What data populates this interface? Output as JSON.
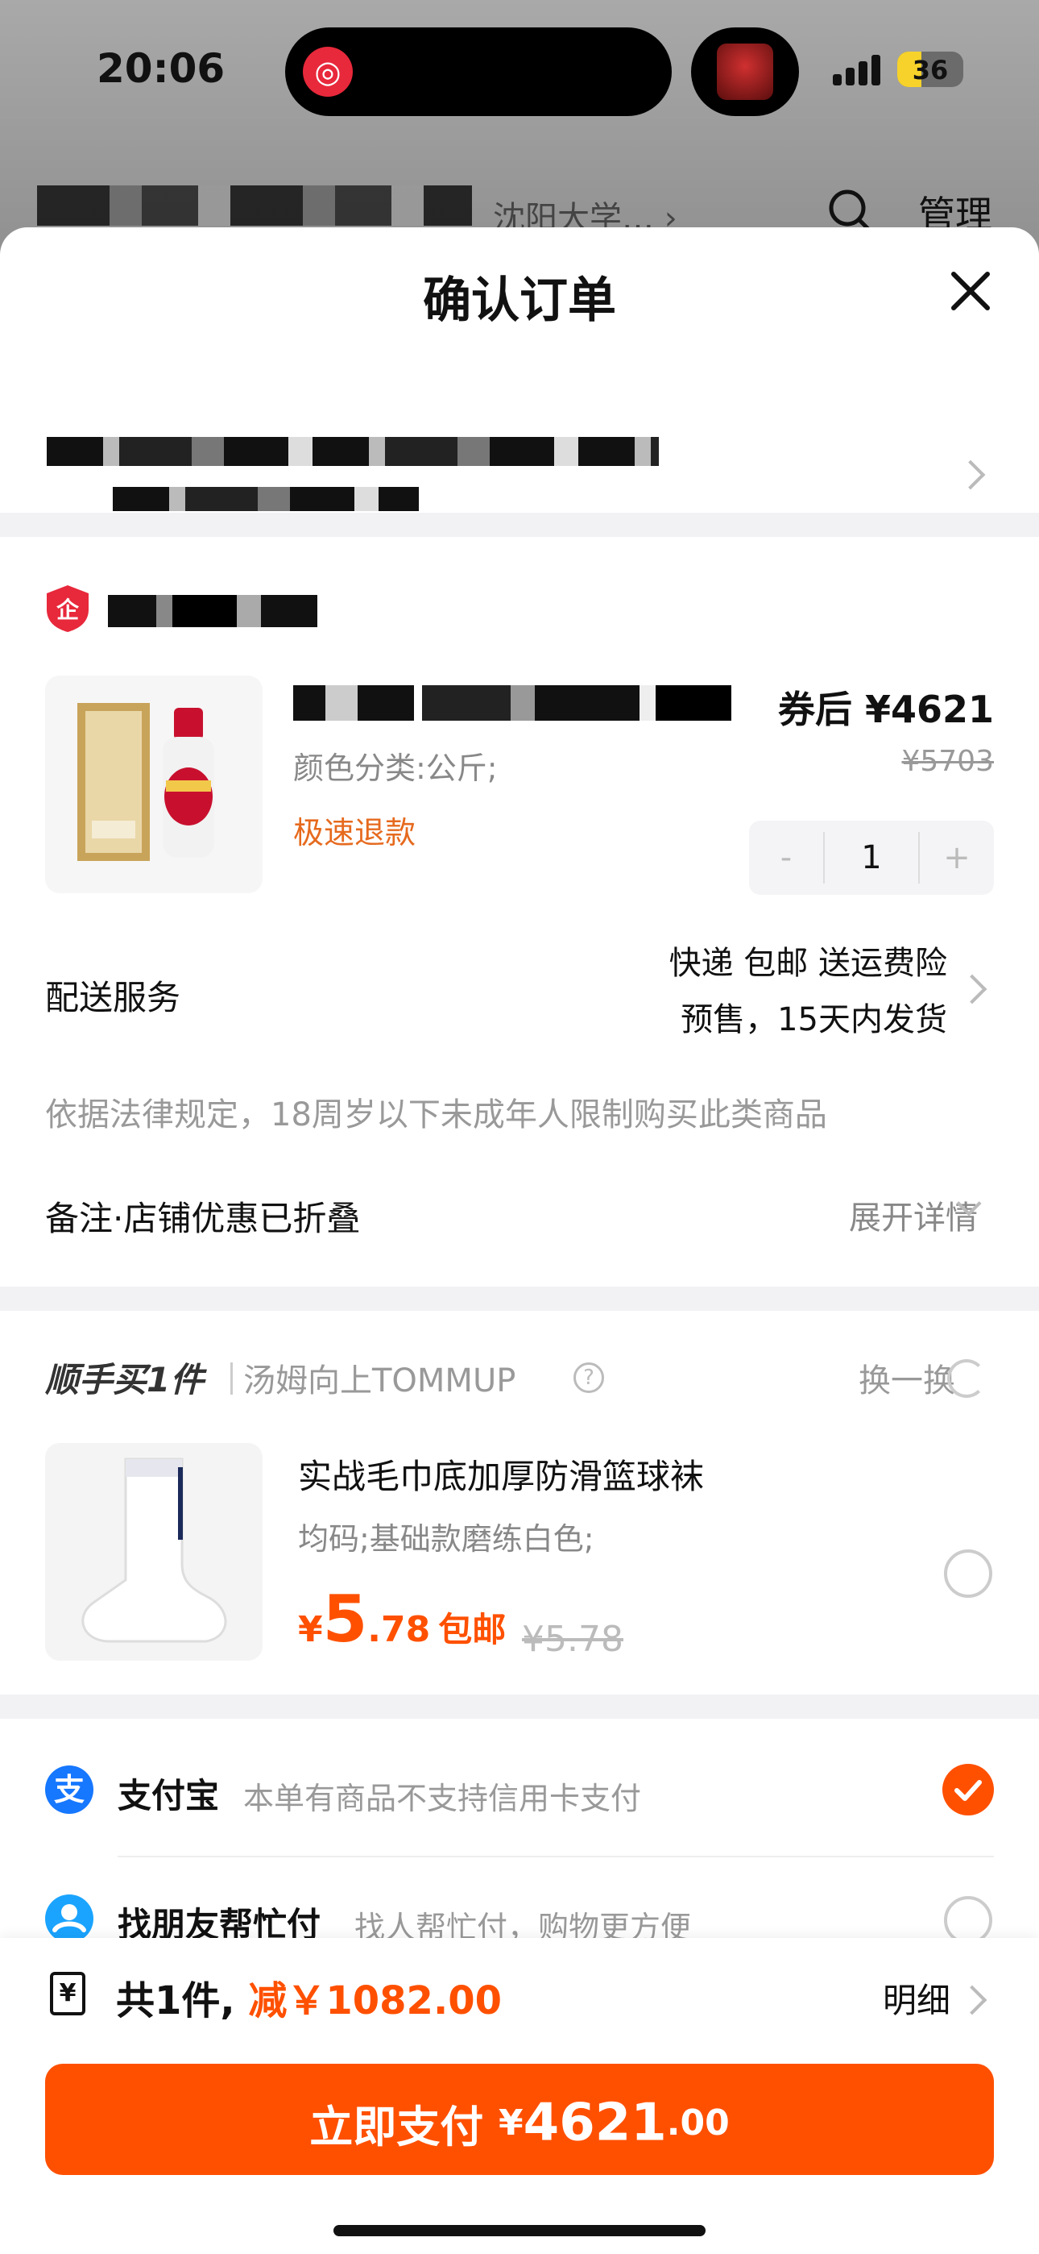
{
  "status": {
    "time": "20:06",
    "battery": "36",
    "island_app_glyph": "◎"
  },
  "underlay": {
    "breadcrumb": "沈阳大学… ›",
    "manage": "管理"
  },
  "sheet": {
    "title": "确认订单"
  },
  "product": {
    "price_after_label": "券后 ¥4621",
    "price_original": "¥5703",
    "spec": "颜色分类:公斤;",
    "tag": "极速退款",
    "qty": "1",
    "qty_minus": "-",
    "qty_plus": "+"
  },
  "delivery": {
    "label": "配送服务",
    "line1": "快递 包邮 送运费险",
    "line2": "预售，15天内发货"
  },
  "notice": "依据法律规定，18周岁以下未成年人限制购买此类商品",
  "remark": {
    "label": "备注·店铺优惠已折叠",
    "expand": "展开详情"
  },
  "addon": {
    "title": "顺手买1件",
    "shop": "汤姆向上TOMMUP",
    "swap": "换一换",
    "item_title": "实战毛巾底加厚防滑篮球袜",
    "item_spec": "均码;基础款磨练白色;",
    "currency": "¥",
    "price_int": "5",
    "price_dec": ".78",
    "free_ship": "包邮",
    "price_original": "¥5.78"
  },
  "payment": {
    "alipay_name": "支付宝",
    "alipay_desc": "本单有商品不支持信用卡支付",
    "friend_name": "找朋友帮忙付",
    "friend_desc": "找人帮忙付，购物更方便",
    "alipay_glyph": "支"
  },
  "bottom": {
    "count": "共1件,",
    "discount": "减￥1082.00",
    "detail": "明细",
    "pay_label": "立即支付 ",
    "pay_currency": "¥",
    "pay_int": "4621",
    "pay_dec": ".00",
    "bill_glyph": "¥"
  },
  "colors": {
    "accent": "#ff5000",
    "tag": "#e66a1e",
    "alipay": "#1677ff"
  }
}
